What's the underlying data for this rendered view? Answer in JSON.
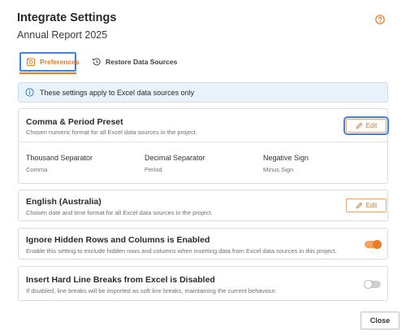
{
  "dialog": {
    "title": "Integrate Settings",
    "subtitle": "Annual Report 2025",
    "help_icon": "help-circle-icon"
  },
  "tabs": [
    {
      "label": "Preferences",
      "icon": "preferences-icon",
      "active": true
    },
    {
      "label": "Restore Data Sources",
      "icon": "history-icon",
      "active": false
    }
  ],
  "info_banner": {
    "text": "These settings apply to Excel data sources only",
    "icon": "info-icon"
  },
  "number_format": {
    "title": "Comma & Period Preset",
    "description": "Chosen numeric format for all Excel data sources in the project.",
    "edit_label": "Edit",
    "columns": [
      {
        "label": "Thousand Separator",
        "value": "Comma"
      },
      {
        "label": "Decimal Separator",
        "value": "Period"
      },
      {
        "label": "Negative Sign",
        "value": "Minus Sign"
      }
    ]
  },
  "date_format": {
    "title": "English (Australia)",
    "description": "Chosen date and time format for all Excel data sources in the project.",
    "edit_label": "Edit"
  },
  "hidden_rows": {
    "title": "Ignore Hidden Rows and Columns is Enabled",
    "description": "Enable this setting to exclude hidden rows and columns when inserting data from Excel data sources in this project.",
    "enabled": true
  },
  "line_breaks": {
    "title": "Insert Hard Line Breaks from Excel is Disabled",
    "description": "If disabled, line breaks will be imported as soft line breaks, maintaining the current behaviour.",
    "enabled": false
  },
  "footer": {
    "close_label": "Close"
  },
  "colors": {
    "accent": "#e77b22",
    "focus": "#3f82e6",
    "info_bg": "#e7f2fb"
  }
}
